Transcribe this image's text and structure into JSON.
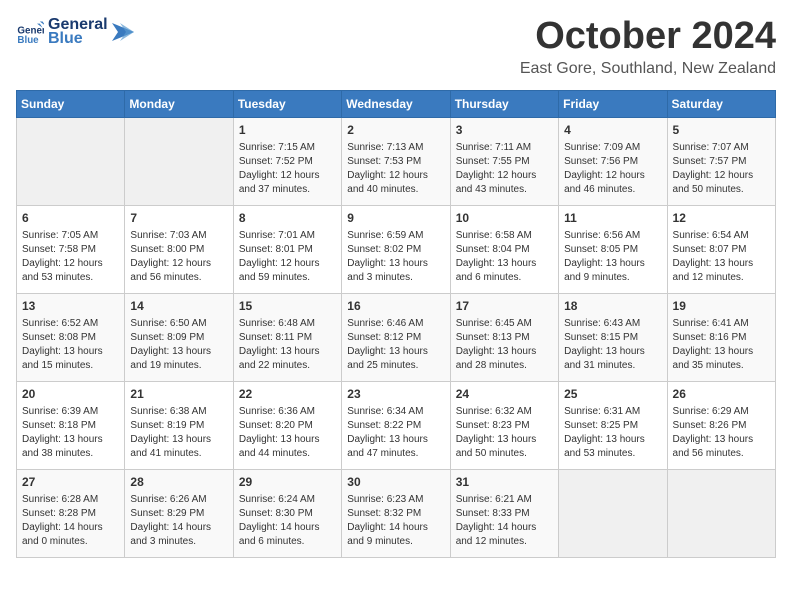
{
  "logo": {
    "line1": "General",
    "line2": "Blue"
  },
  "title": "October 2024",
  "location": "East Gore, Southland, New Zealand",
  "weekdays": [
    "Sunday",
    "Monday",
    "Tuesday",
    "Wednesday",
    "Thursday",
    "Friday",
    "Saturday"
  ],
  "weeks": [
    [
      {
        "day": "",
        "info": ""
      },
      {
        "day": "",
        "info": ""
      },
      {
        "day": "1",
        "info": "Sunrise: 7:15 AM\nSunset: 7:52 PM\nDaylight: 12 hours\nand 37 minutes."
      },
      {
        "day": "2",
        "info": "Sunrise: 7:13 AM\nSunset: 7:53 PM\nDaylight: 12 hours\nand 40 minutes."
      },
      {
        "day": "3",
        "info": "Sunrise: 7:11 AM\nSunset: 7:55 PM\nDaylight: 12 hours\nand 43 minutes."
      },
      {
        "day": "4",
        "info": "Sunrise: 7:09 AM\nSunset: 7:56 PM\nDaylight: 12 hours\nand 46 minutes."
      },
      {
        "day": "5",
        "info": "Sunrise: 7:07 AM\nSunset: 7:57 PM\nDaylight: 12 hours\nand 50 minutes."
      }
    ],
    [
      {
        "day": "6",
        "info": "Sunrise: 7:05 AM\nSunset: 7:58 PM\nDaylight: 12 hours\nand 53 minutes."
      },
      {
        "day": "7",
        "info": "Sunrise: 7:03 AM\nSunset: 8:00 PM\nDaylight: 12 hours\nand 56 minutes."
      },
      {
        "day": "8",
        "info": "Sunrise: 7:01 AM\nSunset: 8:01 PM\nDaylight: 12 hours\nand 59 minutes."
      },
      {
        "day": "9",
        "info": "Sunrise: 6:59 AM\nSunset: 8:02 PM\nDaylight: 13 hours\nand 3 minutes."
      },
      {
        "day": "10",
        "info": "Sunrise: 6:58 AM\nSunset: 8:04 PM\nDaylight: 13 hours\nand 6 minutes."
      },
      {
        "day": "11",
        "info": "Sunrise: 6:56 AM\nSunset: 8:05 PM\nDaylight: 13 hours\nand 9 minutes."
      },
      {
        "day": "12",
        "info": "Sunrise: 6:54 AM\nSunset: 8:07 PM\nDaylight: 13 hours\nand 12 minutes."
      }
    ],
    [
      {
        "day": "13",
        "info": "Sunrise: 6:52 AM\nSunset: 8:08 PM\nDaylight: 13 hours\nand 15 minutes."
      },
      {
        "day": "14",
        "info": "Sunrise: 6:50 AM\nSunset: 8:09 PM\nDaylight: 13 hours\nand 19 minutes."
      },
      {
        "day": "15",
        "info": "Sunrise: 6:48 AM\nSunset: 8:11 PM\nDaylight: 13 hours\nand 22 minutes."
      },
      {
        "day": "16",
        "info": "Sunrise: 6:46 AM\nSunset: 8:12 PM\nDaylight: 13 hours\nand 25 minutes."
      },
      {
        "day": "17",
        "info": "Sunrise: 6:45 AM\nSunset: 8:13 PM\nDaylight: 13 hours\nand 28 minutes."
      },
      {
        "day": "18",
        "info": "Sunrise: 6:43 AM\nSunset: 8:15 PM\nDaylight: 13 hours\nand 31 minutes."
      },
      {
        "day": "19",
        "info": "Sunrise: 6:41 AM\nSunset: 8:16 PM\nDaylight: 13 hours\nand 35 minutes."
      }
    ],
    [
      {
        "day": "20",
        "info": "Sunrise: 6:39 AM\nSunset: 8:18 PM\nDaylight: 13 hours\nand 38 minutes."
      },
      {
        "day": "21",
        "info": "Sunrise: 6:38 AM\nSunset: 8:19 PM\nDaylight: 13 hours\nand 41 minutes."
      },
      {
        "day": "22",
        "info": "Sunrise: 6:36 AM\nSunset: 8:20 PM\nDaylight: 13 hours\nand 44 minutes."
      },
      {
        "day": "23",
        "info": "Sunrise: 6:34 AM\nSunset: 8:22 PM\nDaylight: 13 hours\nand 47 minutes."
      },
      {
        "day": "24",
        "info": "Sunrise: 6:32 AM\nSunset: 8:23 PM\nDaylight: 13 hours\nand 50 minutes."
      },
      {
        "day": "25",
        "info": "Sunrise: 6:31 AM\nSunset: 8:25 PM\nDaylight: 13 hours\nand 53 minutes."
      },
      {
        "day": "26",
        "info": "Sunrise: 6:29 AM\nSunset: 8:26 PM\nDaylight: 13 hours\nand 56 minutes."
      }
    ],
    [
      {
        "day": "27",
        "info": "Sunrise: 6:28 AM\nSunset: 8:28 PM\nDaylight: 14 hours\nand 0 minutes."
      },
      {
        "day": "28",
        "info": "Sunrise: 6:26 AM\nSunset: 8:29 PM\nDaylight: 14 hours\nand 3 minutes."
      },
      {
        "day": "29",
        "info": "Sunrise: 6:24 AM\nSunset: 8:30 PM\nDaylight: 14 hours\nand 6 minutes."
      },
      {
        "day": "30",
        "info": "Sunrise: 6:23 AM\nSunset: 8:32 PM\nDaylight: 14 hours\nand 9 minutes."
      },
      {
        "day": "31",
        "info": "Sunrise: 6:21 AM\nSunset: 8:33 PM\nDaylight: 14 hours\nand 12 minutes."
      },
      {
        "day": "",
        "info": ""
      },
      {
        "day": "",
        "info": ""
      }
    ]
  ]
}
